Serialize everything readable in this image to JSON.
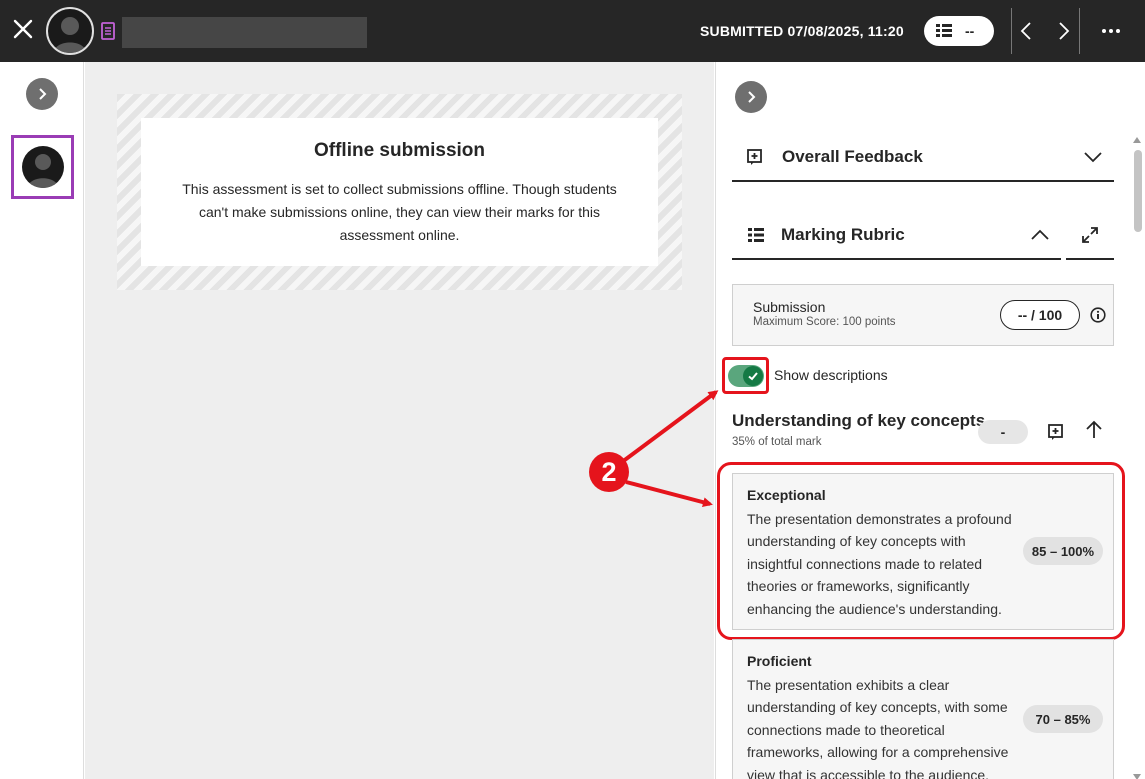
{
  "header": {
    "submitted_text": "SUBMITTED 07/08/2025, 11:20",
    "grade_value": "--",
    "icons": [
      "close-icon",
      "avatar-icon",
      "document-icon",
      "rubric-icon",
      "chevron-left-icon",
      "chevron-right-icon",
      "more-icon"
    ]
  },
  "offline": {
    "title": "Offline submission",
    "text": "This assessment is set to collect submissions offline. Though students can't make submissions online, they can view their marks for this assessment online."
  },
  "panel": {
    "overall_feedback_label": "Overall Feedback",
    "marking_rubric_label": "Marking Rubric",
    "submission": {
      "name": "Submission",
      "max_score": "Maximum Score: 100 points",
      "score": "-- / 100"
    },
    "show_descriptions_label": "Show descriptions",
    "show_descriptions_on": true,
    "criterion": {
      "title": "Understanding of key concepts",
      "weight": "35% of total mark",
      "score": "-",
      "levels": [
        {
          "name": "Exceptional",
          "description": "The presentation demonstrates a profound understanding of key concepts with insightful connections made to related theories or frameworks, significantly enhancing the audience's understanding.",
          "range": "85 – 100%"
        },
        {
          "name": "Proficient",
          "description": "The presentation exhibits a clear understanding of key concepts, with some connections made to theoretical frameworks, allowing for a comprehensive view that is accessible to the audience.",
          "range": "70 – 85%"
        }
      ]
    }
  },
  "annotation": {
    "badge_number": "2"
  },
  "colors": {
    "topbar": "#262626",
    "annotation_red": "#e5141c",
    "toggle_green": "#157a45",
    "selection_purple": "#9a3cb5"
  }
}
